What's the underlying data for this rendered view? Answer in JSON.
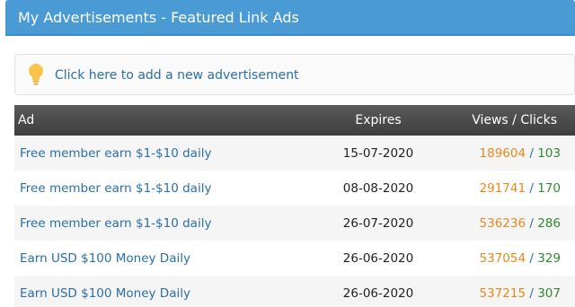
{
  "header": {
    "title": "My Advertisements - Featured Link Ads"
  },
  "add_ad": {
    "label": "Click here to add a new advertisement",
    "icon": "lightbulb-icon"
  },
  "table": {
    "columns": {
      "ad": "Ad",
      "expires": "Expires",
      "views_clicks": "Views / Clicks"
    },
    "rows": [
      {
        "ad": "Free member earn $1-$10 daily",
        "expires": "15-07-2020",
        "views": "189604",
        "clicks": "103"
      },
      {
        "ad": "Free member earn $1-$10 daily",
        "expires": "08-08-2020",
        "views": "291741",
        "clicks": "170"
      },
      {
        "ad": "Free member earn $1-$10 daily",
        "expires": "26-07-2020",
        "views": "536236",
        "clicks": "286"
      },
      {
        "ad": "Earn USD $100 Money Daily",
        "expires": "26-06-2020",
        "views": "537054",
        "clicks": "329"
      },
      {
        "ad": "Earn USD $100 Money Daily",
        "expires": "26-06-2020",
        "views": "537215",
        "clicks": "307"
      }
    ]
  },
  "colors": {
    "header_bg": "#4a9ad6",
    "link": "#2a6fa8",
    "views": "#e8891c",
    "clicks": "#2e8b2e"
  }
}
